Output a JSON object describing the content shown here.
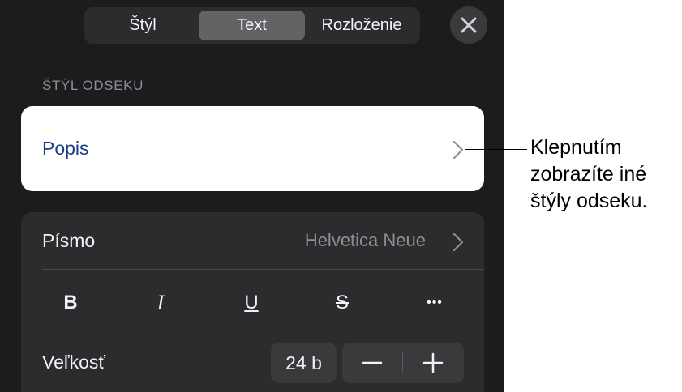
{
  "tabs": [
    "Štýl",
    "Text",
    "Rozloženie"
  ],
  "selected_tab": "Text",
  "section_label": "ŠTÝL ODSEKU",
  "paragraph_style": "Popis",
  "font": {
    "label": "Písmo",
    "value": "Helvetica Neue"
  },
  "format_buttons": [
    "B",
    "I",
    "U",
    "S",
    "•••"
  ],
  "size": {
    "label": "Veľkosť",
    "value": "24 b"
  },
  "callout": [
    "Klepnutím",
    "zobrazíte iné",
    "štýly odseku."
  ],
  "colors": {
    "panel": "#1c1c1e",
    "row": "#2c2c2e",
    "selected_tab": "#636366",
    "style_text": "#1a3f85"
  }
}
